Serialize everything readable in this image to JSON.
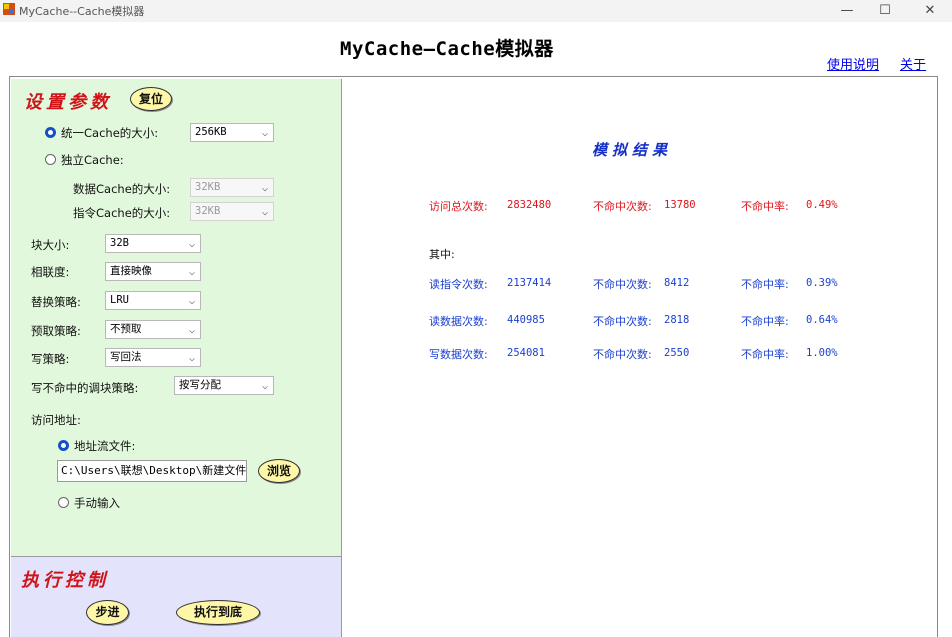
{
  "window": {
    "title": "MyCache--Cache模拟器",
    "minimize": "—",
    "maximize": "☐",
    "close": "✕"
  },
  "header": {
    "title": "MyCache—Cache模拟器",
    "help_link": "使用说明",
    "about_link": "关于"
  },
  "settings": {
    "title": "设置参数",
    "reset_label": "复位",
    "unified_cache_label": "统一Cache的大小:",
    "unified_cache_value": "256KB",
    "split_cache_label": "独立Cache:",
    "data_cache_label": "数据Cache的大小:",
    "data_cache_value": "32KB",
    "instr_cache_label": "指令Cache的大小:",
    "instr_cache_value": "32KB",
    "block_size_label": "块大小:",
    "block_size_value": "32B",
    "assoc_label": "相联度:",
    "assoc_value": "直接映像",
    "replace_label": "替换策略:",
    "replace_value": "LRU",
    "prefetch_label": "预取策略:",
    "prefetch_value": "不预取",
    "write_label": "写策略:",
    "write_value": "写回法",
    "write_miss_label": "写不命中的调块策略:",
    "write_miss_value": "按写分配",
    "address_label": "访问地址:",
    "address_file_label": "地址流文件:",
    "address_file_path": "C:\\Users\\联想\\Desktop\\新建文件夹\\",
    "browse_label": "浏览",
    "manual_label": "手动输入"
  },
  "execution": {
    "title": "执行控制",
    "step_label": "步进",
    "run_label": "执行到底"
  },
  "results": {
    "title": "模拟结果",
    "total": {
      "access_label": "访问总次数:",
      "access_value": "2832480",
      "miss_label": "不命中次数:",
      "miss_value": "13780",
      "rate_label": "不命中率:",
      "rate_value": "0.49%"
    },
    "among_label": "其中:",
    "rows": [
      {
        "access_label": "读指令次数:",
        "access_value": "2137414",
        "miss_label": "不命中次数:",
        "miss_value": "8412",
        "rate_label": "不命中率:",
        "rate_value": "0.39%"
      },
      {
        "access_label": "读数据次数:",
        "access_value": "440985",
        "miss_label": "不命中次数:",
        "miss_value": "2818",
        "rate_label": "不命中率:",
        "rate_value": "0.64%"
      },
      {
        "access_label": "写数据次数:",
        "access_value": "254081",
        "miss_label": "不命中次数:",
        "miss_value": "2550",
        "rate_label": "不命中率:",
        "rate_value": "1.00%"
      }
    ]
  },
  "colors": {
    "settings_bg": "#e2f8dc",
    "exec_bg": "#e3e3fb",
    "section_title": "#d0141a",
    "result_blue": "#1a3fd0",
    "result_red": "#e0141a",
    "button_fill": "#fff7a8"
  }
}
